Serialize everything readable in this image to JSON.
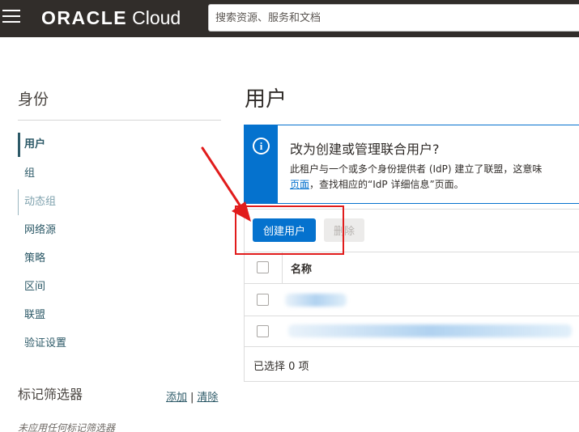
{
  "header": {
    "logo_text": "ORACLE",
    "logo_product": "Cloud",
    "search_placeholder": "搜索资源、服务和文档"
  },
  "sidebar": {
    "title": "身份",
    "items": [
      {
        "label": "用户"
      },
      {
        "label": "组"
      },
      {
        "label": "动态组"
      },
      {
        "label": "网络源"
      },
      {
        "label": "策略"
      },
      {
        "label": "区间"
      },
      {
        "label": "联盟"
      },
      {
        "label": "验证设置"
      }
    ],
    "tag_filter": {
      "title": "标记筛选器",
      "add_label": "添加",
      "separator": "|",
      "clear_label": "清除",
      "empty_text": "未应用任何标记筛选器"
    }
  },
  "main": {
    "title": "用户",
    "info": {
      "heading": "改为创建或管理联合用户?",
      "body_line1": "此租户与一个或多个身份提供者 (IdP) 建立了联盟，这意味",
      "body_link": "页面",
      "body_line2": "，查找相应的“IdP 详细信息”页面。"
    },
    "toolbar": {
      "create_label": "创建用户",
      "delete_label": "删除"
    },
    "table": {
      "column_name": "名称",
      "selected_text": "已选择 0 项"
    }
  },
  "colors": {
    "topbar": "#312d2a",
    "accent": "#0572ce",
    "sidebar_link": "#2c5967",
    "annotation": "#e11c1c"
  }
}
